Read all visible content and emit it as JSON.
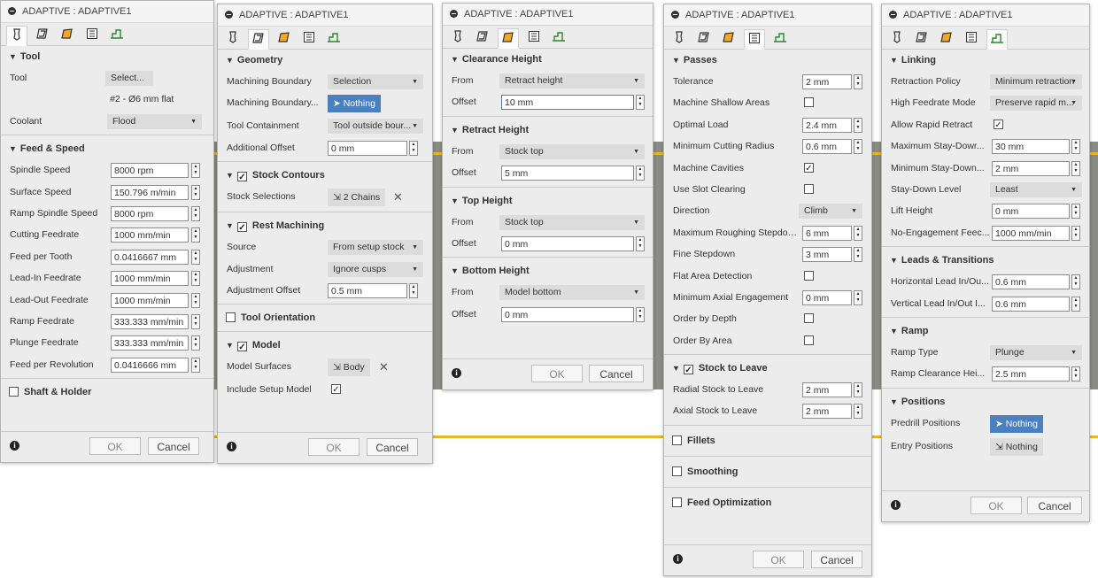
{
  "p1": {
    "title": "ADAPTIVE : ADAPTIVE1",
    "sections": {
      "tool": "Tool",
      "feed_speed": "Feed & Speed",
      "shaft": "Shaft & Holder"
    },
    "tool": {
      "label": "Tool",
      "button": "Select...",
      "desc": "#2 - Ø6 mm flat"
    },
    "coolant": {
      "label": "Coolant",
      "value": "Flood"
    },
    "fields": [
      {
        "label": "Spindle Speed",
        "value": "8000 rpm"
      },
      {
        "label": "Surface Speed",
        "value": "150.796 m/min"
      },
      {
        "label": "Ramp Spindle Speed",
        "value": "8000 rpm"
      },
      {
        "label": "Cutting Feedrate",
        "value": "1000 mm/min"
      },
      {
        "label": "Feed per Tooth",
        "value": "0.0416667 mm"
      },
      {
        "label": "Lead-In Feedrate",
        "value": "1000 mm/min"
      },
      {
        "label": "Lead-Out Feedrate",
        "value": "1000 mm/min"
      },
      {
        "label": "Ramp Feedrate",
        "value": "333.333 mm/min"
      },
      {
        "label": "Plunge Feedrate",
        "value": "333.333 mm/min"
      },
      {
        "label": "Feed per Revolution",
        "value": "0.0416666 mm"
      }
    ],
    "ok": "OK",
    "cancel": "Cancel"
  },
  "p2": {
    "title": "ADAPTIVE : ADAPTIVE1",
    "sections": {
      "geometry": "Geometry",
      "stock_contours": "Stock Contours",
      "rest": "Rest Machining",
      "orientation": "Tool Orientation",
      "model": "Model"
    },
    "machining_boundary": {
      "label": "Machining Boundary",
      "value": "Selection"
    },
    "machining_boundary_sel": {
      "label": "Machining Boundary...",
      "value": "Nothing"
    },
    "tool_containment": {
      "label": "Tool Containment",
      "value": "Tool outside bour..."
    },
    "additional_offset": {
      "label": "Additional Offset",
      "value": "0 mm"
    },
    "stock_selections": {
      "label": "Stock Selections",
      "value": "2 Chains"
    },
    "source": {
      "label": "Source",
      "value": "From setup stock"
    },
    "adjustment": {
      "label": "Adjustment",
      "value": "Ignore cusps"
    },
    "adjustment_offset": {
      "label": "Adjustment Offset",
      "value": "0.5 mm"
    },
    "model_surfaces": {
      "label": "Model Surfaces",
      "value": "Body"
    },
    "include_setup_model": {
      "label": "Include Setup Model"
    },
    "ok": "OK",
    "cancel": "Cancel"
  },
  "p3": {
    "title": "ADAPTIVE : ADAPTIVE1",
    "sections": {
      "clearance": "Clearance Height",
      "retract": "Retract Height",
      "top": "Top Height",
      "bottom": "Bottom Height"
    },
    "from_label": "From",
    "offset_label": "Offset",
    "clearance": {
      "from": "Retract height",
      "offset": "10 mm"
    },
    "retract": {
      "from": "Stock top",
      "offset": "5 mm"
    },
    "top": {
      "from": "Stock top",
      "offset": "0 mm"
    },
    "bottom": {
      "from": "Model bottom",
      "offset": "0 mm"
    },
    "ok": "OK",
    "cancel": "Cancel"
  },
  "p4": {
    "title": "ADAPTIVE : ADAPTIVE1",
    "sections": {
      "passes": "Passes",
      "stock_to_leave": "Stock to Leave",
      "fillets": "Fillets",
      "smoothing": "Smoothing",
      "feed_opt": "Feed Optimization"
    },
    "tolerance": {
      "label": "Tolerance",
      "value": "2 mm"
    },
    "shallow": {
      "label": "Machine Shallow Areas"
    },
    "optimal_load": {
      "label": "Optimal Load",
      "value": "2.4 mm"
    },
    "min_cut_radius": {
      "label": "Minimum Cutting Radius",
      "value": "0.6 mm"
    },
    "cavities": {
      "label": "Machine Cavities"
    },
    "slot": {
      "label": "Use Slot Clearing"
    },
    "direction": {
      "label": "Direction",
      "value": "Climb"
    },
    "max_rough": {
      "label": "Maximum Roughing Stepdov...",
      "value": "6 mm"
    },
    "fine_step": {
      "label": "Fine Stepdown",
      "value": "3 mm"
    },
    "flat_area": {
      "label": "Flat Area Detection"
    },
    "min_axial": {
      "label": "Minimum Axial Engagement",
      "value": "0 mm"
    },
    "order_depth": {
      "label": "Order by Depth"
    },
    "order_area": {
      "label": "Order By Area"
    },
    "radial": {
      "label": "Radial Stock to Leave",
      "value": "2 mm"
    },
    "axial": {
      "label": "Axial Stock to Leave",
      "value": "2 mm"
    },
    "ok": "OK",
    "cancel": "Cancel"
  },
  "p5": {
    "title": "ADAPTIVE : ADAPTIVE1",
    "sections": {
      "linking": "Linking",
      "leads": "Leads & Transitions",
      "ramp": "Ramp",
      "positions": "Positions"
    },
    "retraction": {
      "label": "Retraction Policy",
      "value": "Minimum retraction"
    },
    "hfm": {
      "label": "High Feedrate Mode",
      "value": "Preserve rapid m..."
    },
    "rapid_retract": {
      "label": "Allow Rapid Retract"
    },
    "max_stay": {
      "label": "Maximum Stay-Dowr...",
      "value": "30 mm"
    },
    "min_stay": {
      "label": "Minimum Stay-Down...",
      "value": "2 mm"
    },
    "stay_level": {
      "label": "Stay-Down Level",
      "value": "Least"
    },
    "lift": {
      "label": "Lift Height",
      "value": "0 mm"
    },
    "noeng": {
      "label": "No-Engagement Feec...",
      "value": "1000 mm/min"
    },
    "h_lead": {
      "label": "Horizontal Lead In/Ou...",
      "value": "0.6 mm"
    },
    "v_lead": {
      "label": "Vertical Lead In/Out I...",
      "value": "0.6 mm"
    },
    "ramp_type": {
      "label": "Ramp Type",
      "value": "Plunge"
    },
    "ramp_clear": {
      "label": "Ramp Clearance Hei...",
      "value": "2.5 mm"
    },
    "predrill": {
      "label": "Predrill Positions",
      "value": "Nothing"
    },
    "entry": {
      "label": "Entry Positions",
      "value": "Nothing"
    },
    "ok": "OK",
    "cancel": "Cancel"
  }
}
